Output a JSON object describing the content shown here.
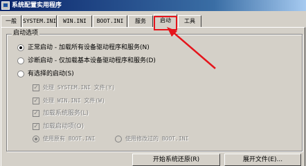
{
  "window": {
    "title": "系统配置实用程序"
  },
  "tabs": [
    {
      "label": "一般"
    },
    {
      "label": "SYSTEM.INI"
    },
    {
      "label": "WIN.INI"
    },
    {
      "label": "BOOT.INI"
    },
    {
      "label": "服务"
    },
    {
      "label": "启动"
    },
    {
      "label": "工具"
    }
  ],
  "startup_selection": {
    "caption": "启动选项",
    "normal_label": "正常启动 - 加载所有设备驱动程序和服务(N)",
    "diagnostic_label": "诊断启动 - 仅加载基本设备驱动程序和服务(D)",
    "selective_label": "有选择的启动(S)",
    "selective_options": {
      "process_system_ini": "处理 SYSTEM.INI 文件(Y)",
      "process_win_ini": "处理 WIN.INI 文件(W)",
      "load_system_services": "加载系统服务(L)",
      "load_startup_items": "加载启动项(O)",
      "use_original_boot_ini": "使用原有 BOOT.INI",
      "use_modified_boot_ini": "使用修改过的 BOOT.INI"
    }
  },
  "buttons": {
    "launch_system_restore": "开始系统还原(R)",
    "expand_file": "展开文件(E)..."
  },
  "annotation": {
    "color": "#e5141b",
    "highlighted_tab": "启动"
  }
}
